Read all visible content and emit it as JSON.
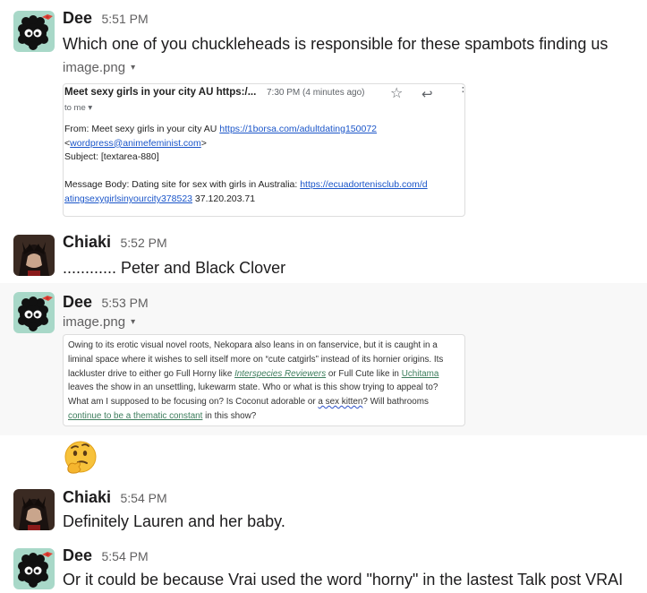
{
  "messages": [
    {
      "author": "Dee",
      "time": "5:51 PM",
      "text": "Which one of you chuckleheads is responsible for these spambots finding us",
      "file": {
        "name": "image.png",
        "caret": "▾",
        "email": {
          "subject": "Meet sexy girls in your city AU https:/...",
          "time": "7:30 PM (4 minutes ago)",
          "to": "to me",
          "to_caret": "▾",
          "star": "☆",
          "reply": "↩",
          "more": "⋮",
          "from_prefix": "From: Meet sexy girls in your city AU ",
          "from_link": "https://1borsa.com/adultdating150072",
          "sender_open": "<",
          "sender_email": "wordpress@animefeminist.com",
          "sender_close": ">",
          "subject_line": "Subject: [textarea-880]",
          "body_prefix": "Message Body: Dating site for sex with girls in Australia: ",
          "body_link_1": "https://ecuadortenisclub.com/d",
          "body_link_2": "atingsexygirlsinyourcity378523",
          "body_ip": " 37.120.203.71"
        }
      }
    },
    {
      "author": "Chiaki",
      "time": "5:52 PM",
      "text": "............ Peter and Black Clover"
    },
    {
      "author": "Dee",
      "time": "5:53 PM",
      "file": {
        "name": "image.png",
        "caret": "▾",
        "quote": {
          "l1": "Owing to its erotic visual novel roots, Nekopara also leans in on fanservice, but it is caught in a",
          "l2": "liminal space where it wishes to sell itself more on “cute catgirls” instead of its hornier origins. Its",
          "l3a": "lackluster drive to either go Full Horny like ",
          "l3link1": "Interspecies Reviewers",
          "l3b": " or Full Cute like in ",
          "l3link2": "Uchitama",
          "l4": "leaves the show in an unsettling, lukewarm state. Who or what is this show trying to appeal to?",
          "l5a": "What am I supposed to be focusing on? Is Coconut adorable or ",
          "l5b": "a sex kitten",
          "l5c": "? Will bathrooms",
          "l6link": "continue to be a thematic constant",
          "l6b": " in this show?"
        }
      },
      "reaction": "thinking-face"
    },
    {
      "author": "Chiaki",
      "time": "5:54 PM",
      "text": "Definitely Lauren and her baby."
    },
    {
      "author": "Dee",
      "time": "5:54 PM",
      "text": "Or it could be because Vrai used the word \"horny\" in the lastest Talk post VRAI"
    }
  ],
  "colors": {
    "author": "#1d1c1d",
    "timestamp": "#616061",
    "highlight_row": "#f8f8f8",
    "link_blue": "#1a55c9",
    "link_green": "#3c7d5c",
    "dee_avatar_bg": "#a8d8c8",
    "chiaki_avatar_bg": "#3a2a22"
  }
}
